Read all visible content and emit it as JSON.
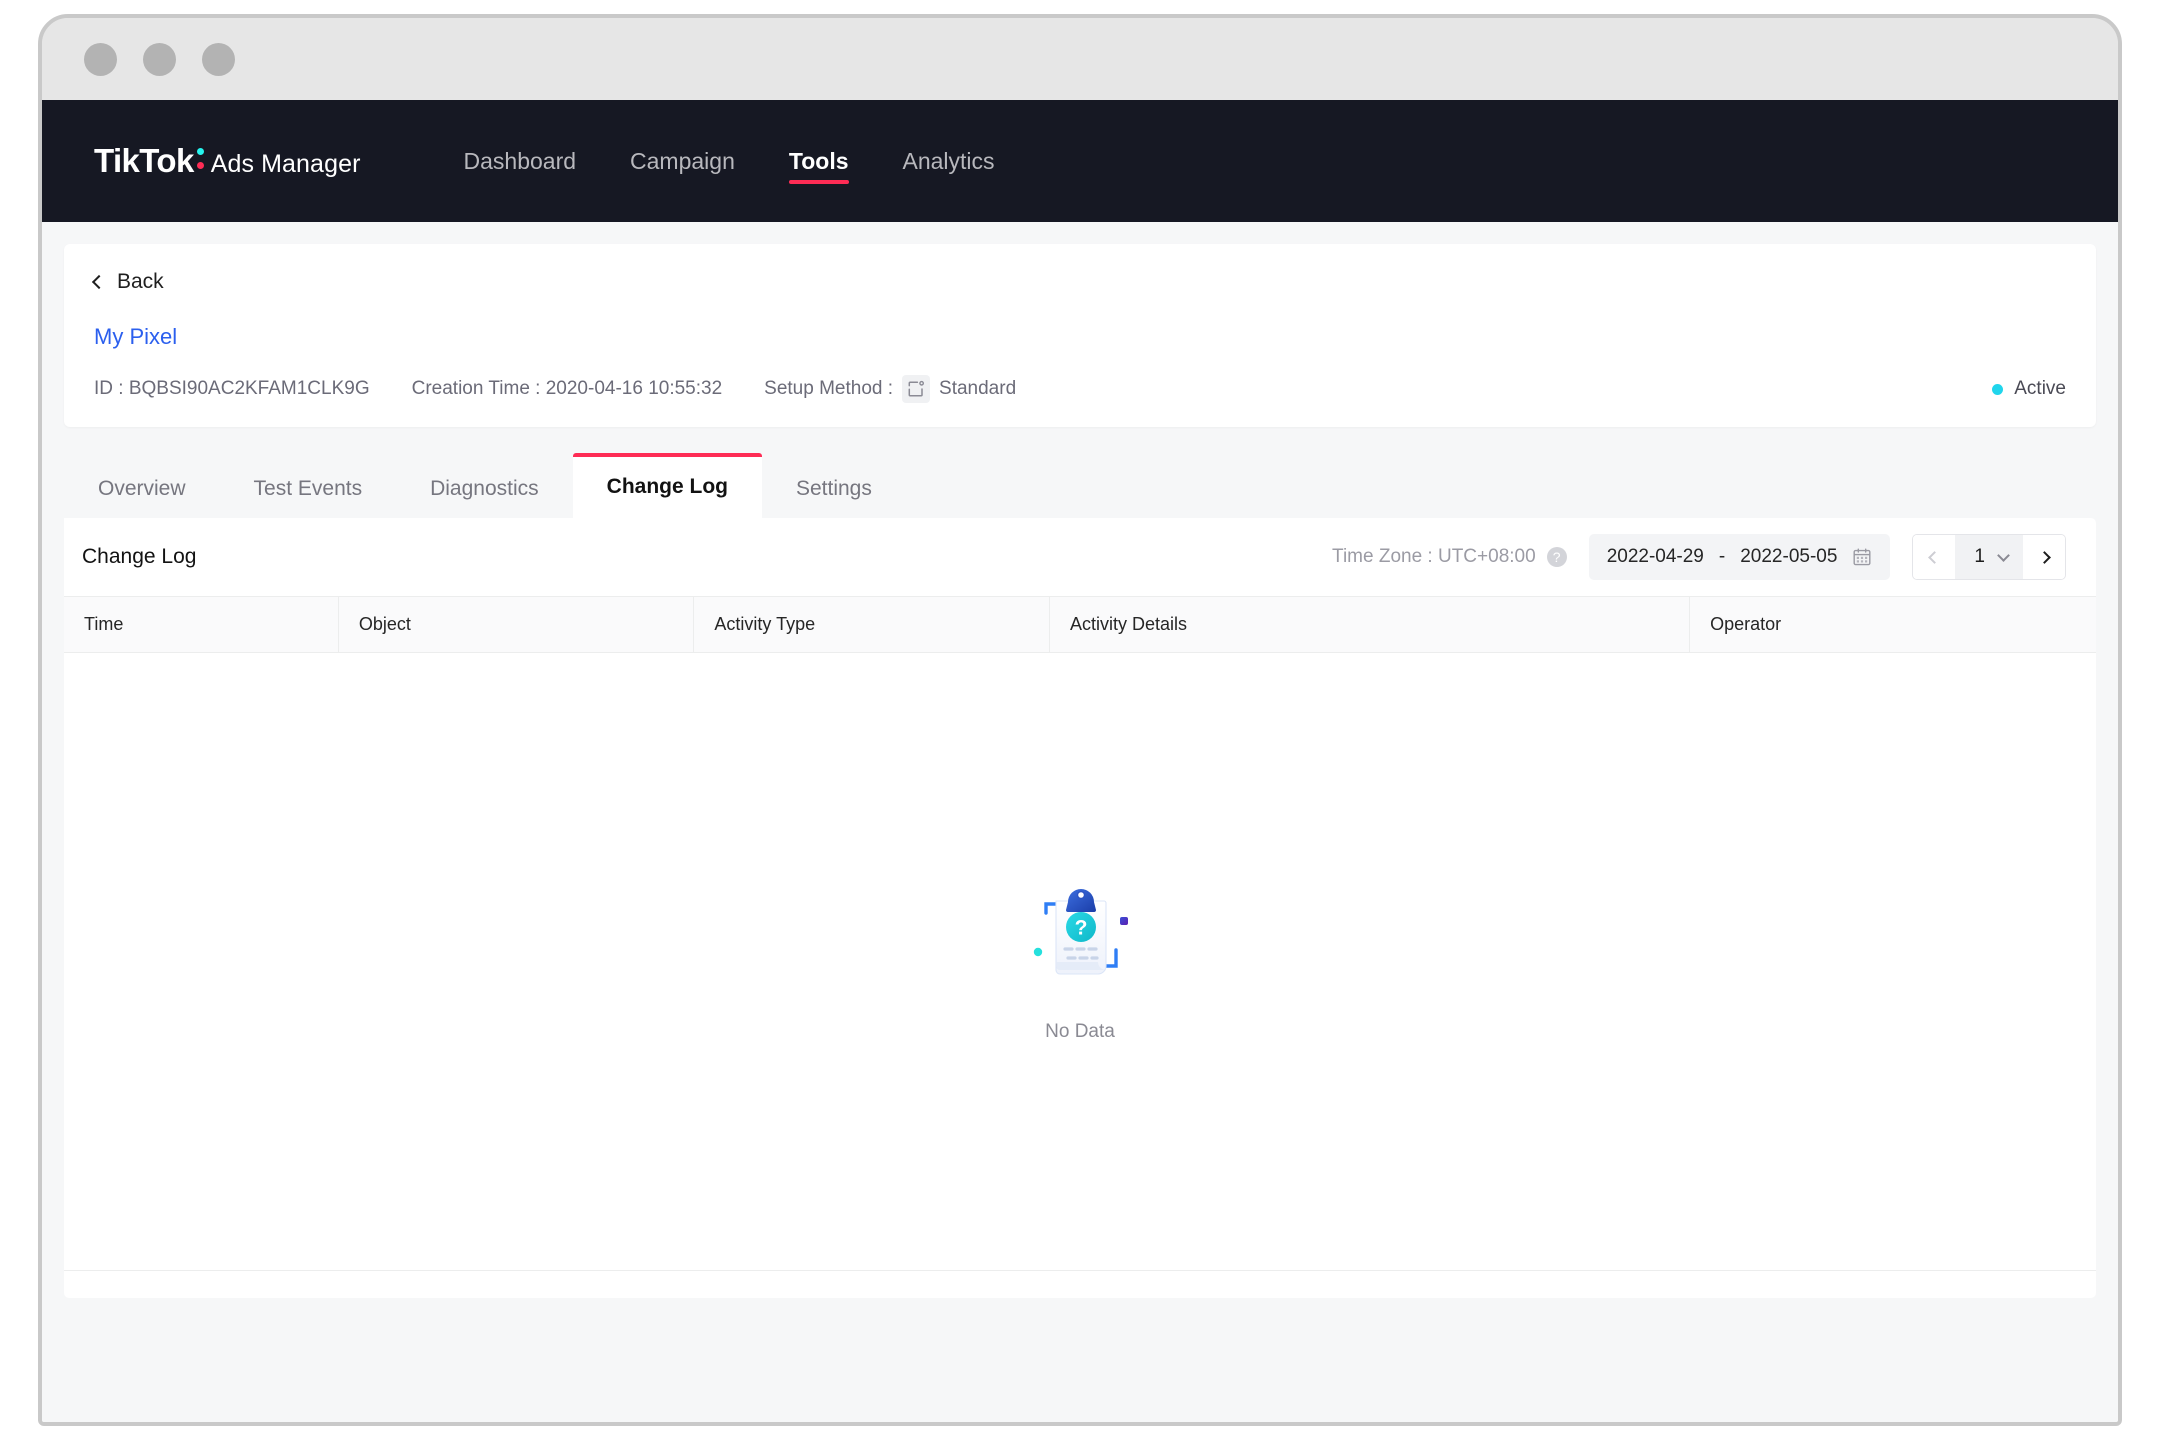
{
  "window": {
    "dots": [
      "close",
      "minimize",
      "maximize"
    ]
  },
  "topnav": {
    "brand_primary": "TikTok",
    "brand_secondary": "Ads Manager",
    "items": [
      {
        "label": "Dashboard",
        "active": false
      },
      {
        "label": "Campaign",
        "active": false
      },
      {
        "label": "Tools",
        "active": true
      },
      {
        "label": "Analytics",
        "active": false
      }
    ],
    "accent_color": "#fe2c55",
    "background_color": "#161823"
  },
  "info_card": {
    "back_label": "Back",
    "pixel_name": "My Pixel",
    "pixel_name_color": "#2b5fee",
    "meta": {
      "id": "ID : BQBSI90AC2KFAM1CLK9G",
      "creation_time": "Creation Time : 2020-04-16 10:55:32",
      "setup_method_label": "Setup Method :",
      "setup_method_value": "Standard"
    },
    "status": {
      "label": "Active",
      "color": "#20d5ec"
    }
  },
  "tabs": [
    {
      "label": "Overview",
      "active": false
    },
    {
      "label": "Test Events",
      "active": false
    },
    {
      "label": "Diagnostics",
      "active": false
    },
    {
      "label": "Change Log",
      "active": true
    },
    {
      "label": "Settings",
      "active": false
    }
  ],
  "panel": {
    "title": "Change Log",
    "timezone_label": "Time Zone : UTC+08:00",
    "help_glyph": "?",
    "date_range": {
      "start": "2022-04-29",
      "separator": "-",
      "end": "2022-05-05"
    },
    "pagination": {
      "page": "1",
      "prev_enabled": false,
      "next_enabled": true
    }
  },
  "table": {
    "columns": [
      "Time",
      "Object",
      "Activity Type",
      "Activity Details",
      "Operator"
    ],
    "rows": [],
    "empty_state": {
      "label": "No Data"
    }
  }
}
